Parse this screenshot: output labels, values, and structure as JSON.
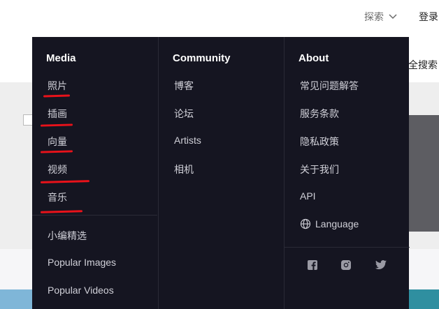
{
  "header": {
    "explore_label": "探索",
    "login_label": "登录"
  },
  "background": {
    "search_all_label": "全搜索"
  },
  "menu": {
    "media": {
      "title": "Media",
      "items": [
        "照片",
        "插画",
        "向量",
        "视频",
        "音乐"
      ],
      "extra": [
        "小编精选",
        "Popular Images",
        "Popular Videos"
      ]
    },
    "community": {
      "title": "Community",
      "items": [
        "博客",
        "论坛",
        "Artists",
        "相机"
      ]
    },
    "about": {
      "title": "About",
      "items": [
        "常见问题解答",
        "服务条款",
        "隐私政策",
        "关于我们",
        "API"
      ],
      "language_label": "Language"
    },
    "social_icons": [
      "facebook-icon",
      "instagram-icon",
      "twitter-icon"
    ]
  },
  "colors": {
    "menu_background": "#151521",
    "annotation_red": "#e8121a"
  }
}
